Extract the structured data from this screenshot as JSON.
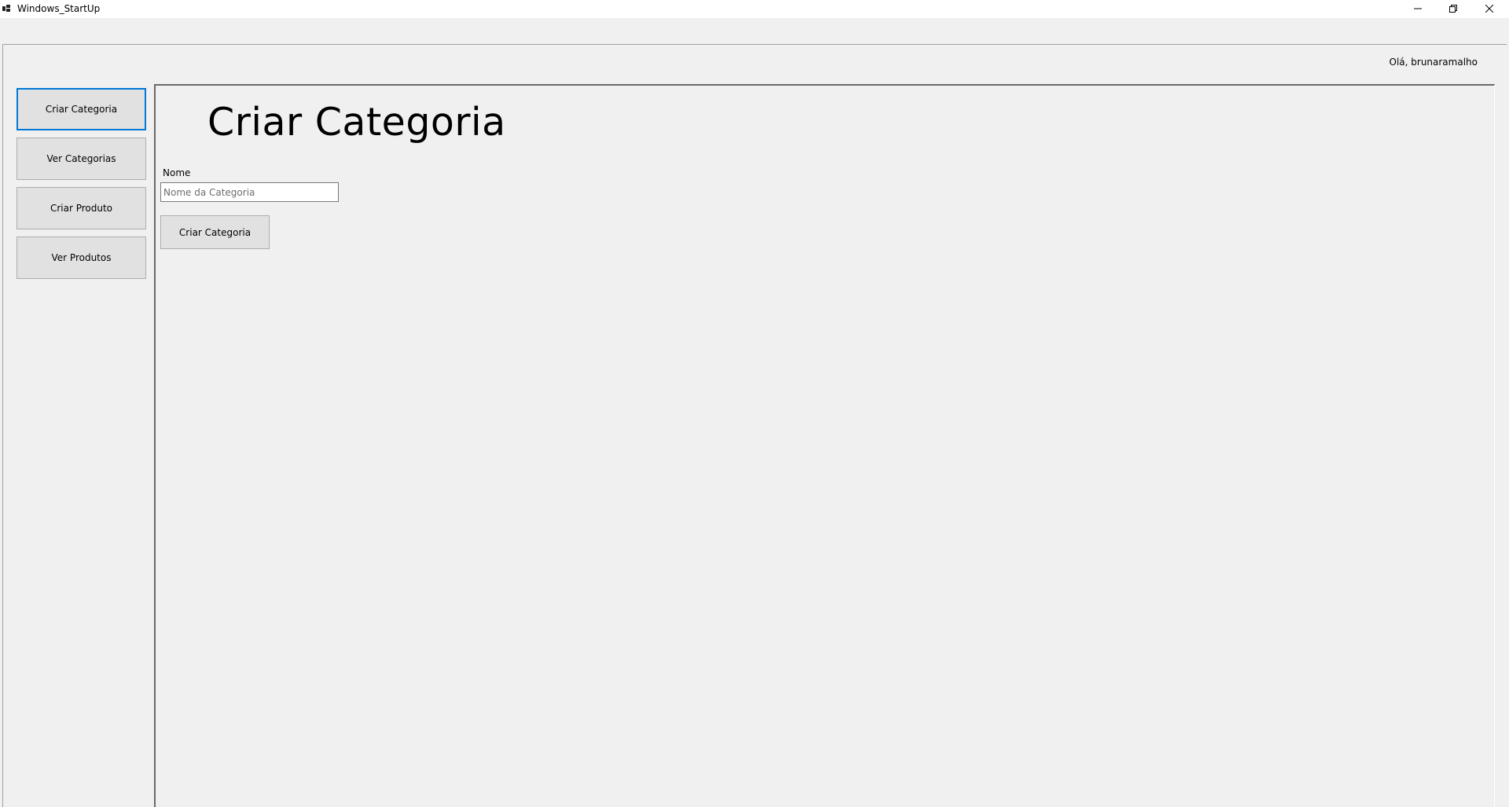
{
  "window": {
    "title": "Windows_StartUp",
    "app_icon": "app-window-icon",
    "controls": {
      "minimize_icon": "minimize-icon",
      "maximize_icon": "restore-icon",
      "close_icon": "close-icon"
    }
  },
  "header": {
    "greeting": "Olá, brunaramalho"
  },
  "sidebar": {
    "items": [
      {
        "label": "Criar Categoria",
        "active": true
      },
      {
        "label": "Ver Categorias",
        "active": false
      },
      {
        "label": "Criar Produto",
        "active": false
      },
      {
        "label": "Ver Produtos",
        "active": false
      }
    ]
  },
  "main": {
    "title": "Criar Categoria",
    "form": {
      "name_label": "Nome",
      "name_value": "",
      "name_placeholder": "Nome da Categoria",
      "submit_label": "Criar Categoria"
    }
  },
  "colors": {
    "active_border": "#0078d7",
    "background": "#f0f0f0",
    "button_face": "#e1e1e1"
  }
}
